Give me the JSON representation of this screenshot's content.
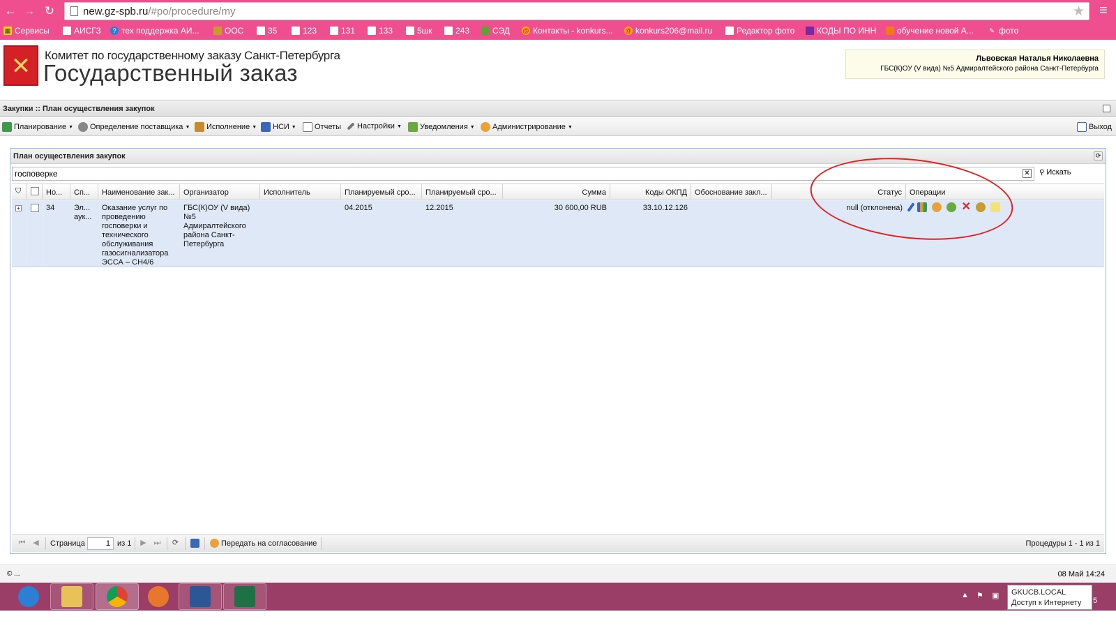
{
  "browser": {
    "url_host": "new.gz-spb.ru",
    "url_path": "/#po/procedure/my",
    "bookmarks": [
      "Сервисы",
      "АИСГЗ",
      "тех поддержка АИ...",
      "ООС",
      "35",
      "123",
      "131",
      "133",
      "5шк",
      "243",
      "СЭД",
      "Контакты - konkurs...",
      "konkurs206@mail.ru",
      "Редактор фото",
      "КОДЫ ПО ИНН",
      "обучение новой А...",
      "фото"
    ]
  },
  "header": {
    "subtitle": "Комитет по государственному заказу Санкт-Петербурга",
    "title": "Государственный заказ",
    "user_name": "Львовская Наталья Николаевна",
    "user_org": "ГБС(К)ОУ (V вида) №5 Адмиралтейского района Санкт-Петербурга"
  },
  "breadcrumb": "Закупки :: План осуществления закупок",
  "menu": {
    "items": [
      "Планирование",
      "Определение поставщика",
      "Исполнение",
      "НСИ",
      "Отчеты",
      "Настройки",
      "Уведомления",
      "Администрирование"
    ],
    "logout": "Выход"
  },
  "panel": {
    "title": "План осуществления закупок",
    "search_value": "госповерке",
    "search_button": "Искать"
  },
  "grid": {
    "columns": [
      "Но...",
      "Сп...",
      "Наименование зак...",
      "Организатор",
      "Исполнитель",
      "Планируемый сро...",
      "Планируемый сро...",
      "Сумма",
      "Коды ОКПД",
      "Обоснование закл...",
      "Статус",
      "Операции"
    ],
    "row": {
      "number": "34",
      "method": "Эл... аук...",
      "name": "Оказание услуг по проведению госповерки и технического обслуживания газосигнализатора ЭССА – СН4/6",
      "organizer": "ГБС(К)ОУ (V вида) №5 Адмиралтейского района Санкт-Петербурга",
      "executor": "",
      "planned_start": "04.2015",
      "planned_end": "12.2015",
      "sum": "30 600,00 RUB",
      "okpd": "33.10.12.126",
      "justification": "",
      "status": "null (отклонена)",
      "operations": [
        "edit-icon",
        "chart-icon",
        "send-icon",
        "gear-icon",
        "delete-icon",
        "emblem-icon",
        "note-icon"
      ]
    }
  },
  "pager": {
    "page_label": "Страница",
    "page_value": "1",
    "of_label": "из 1",
    "send_label": "Передать на согласование",
    "summary": "Процедуры 1 - 1 из 1"
  },
  "status": {
    "left": "© ...",
    "right": "08 Май 14:24"
  },
  "tray": {
    "tooltip_line1": "GKUCB.LOCAL",
    "tooltip_line2": "Доступ к Интернету",
    "num": "5"
  },
  "colors": {
    "chrome": "#ef4f8e",
    "taskbar": "#9a3e67",
    "row_selected": "#dfe8f6",
    "annotation": "#e02020"
  }
}
